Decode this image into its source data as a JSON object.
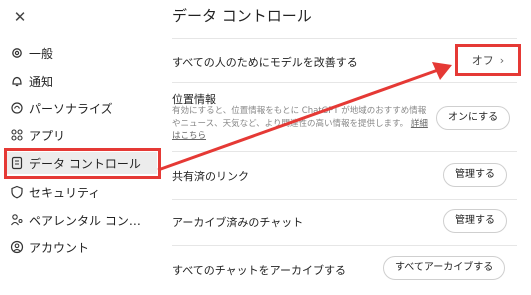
{
  "close_label": "✕",
  "sidebar": {
    "items": [
      {
        "label": "一般",
        "icon": "gear-icon"
      },
      {
        "label": "通知",
        "icon": "bell-icon"
      },
      {
        "label": "パーソナライズ",
        "icon": "personalize-icon"
      },
      {
        "label": "アプリ",
        "icon": "apps-icon"
      },
      {
        "label": "データ コントロール",
        "icon": "data-controls-icon",
        "active": true
      },
      {
        "label": "セキュリティ",
        "icon": "security-icon"
      },
      {
        "label": "ペアレンタル コント…",
        "icon": "parental-icon"
      },
      {
        "label": "アカウント",
        "icon": "account-icon"
      }
    ]
  },
  "main": {
    "title": "データ コントロール",
    "improve_model": {
      "label": "すべての人のためにモデルを改善する",
      "value": "オフ",
      "chevron": "›"
    },
    "location": {
      "label": "位置情報",
      "description": "有効にすると、位置情報をもとに ChatGPT が地域のおすすめ情報やニュース、天気など、より関連性の高い情報を提供します。",
      "link": "詳細はこちら",
      "button": "オンにする"
    },
    "shared_links": {
      "label": "共有済のリンク",
      "button": "管理する"
    },
    "archived_chats": {
      "label": "アーカイブ済みのチャット",
      "button": "管理する"
    },
    "archive_all": {
      "label": "すべてのチャットをアーカイブする",
      "button": "すべてアーカイブする"
    }
  },
  "colors": {
    "annotation_red": "#e53935",
    "active_bg": "#ececec"
  }
}
